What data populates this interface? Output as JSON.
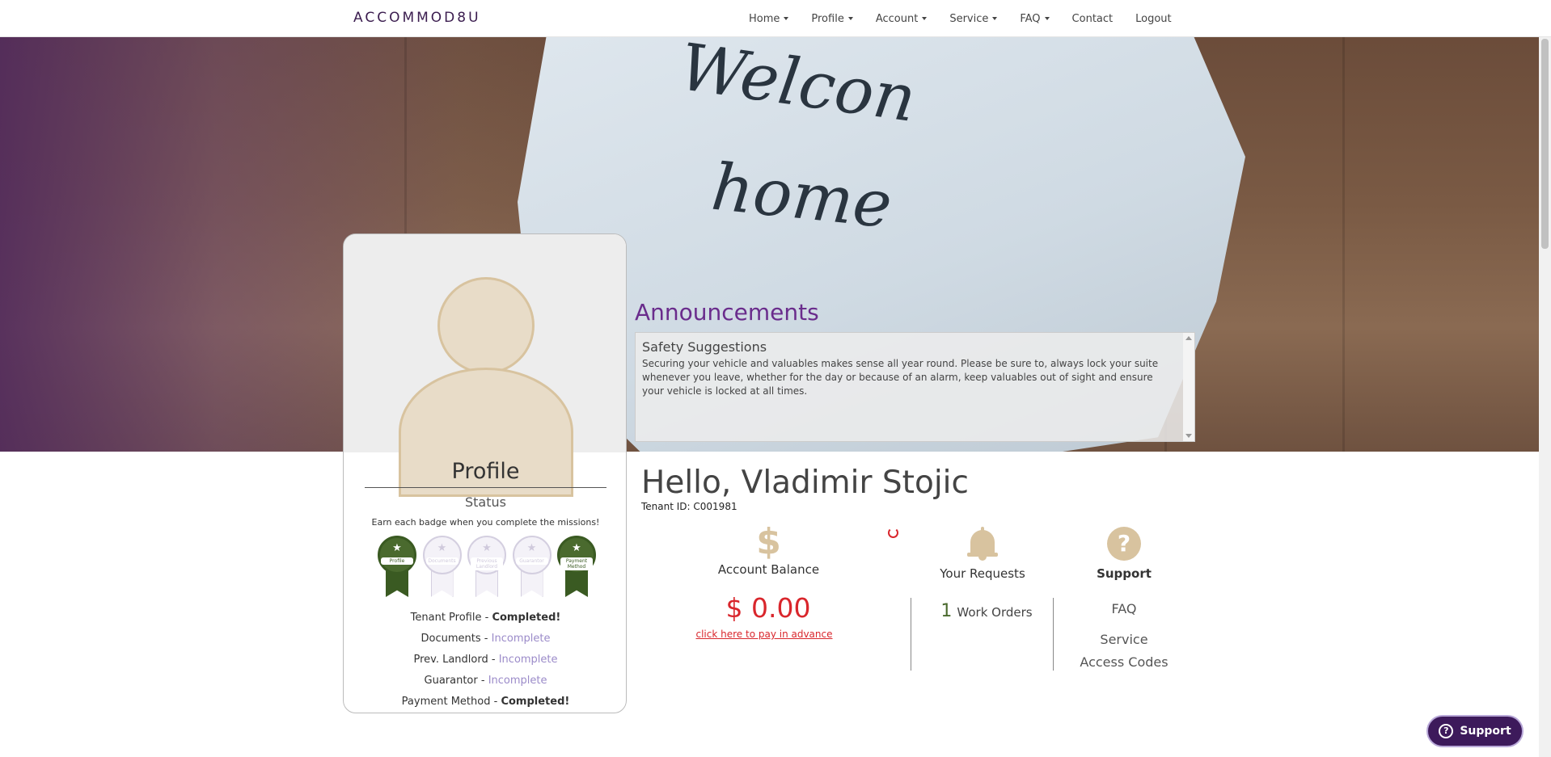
{
  "brand": "ACCOMMOD8U",
  "nav": {
    "home": "Home",
    "profile": "Profile",
    "account": "Account",
    "service": "Service",
    "faq": "FAQ",
    "contact": "Contact",
    "logout": "Logout"
  },
  "hero": {
    "line1": "Welcon",
    "line2": "home"
  },
  "announcements": {
    "title": "Announcements",
    "item_title": "Safety Suggestions",
    "item_body": "Securing your vehicle and valuables makes sense all year round. Please be sure to, always lock your suite whenever you leave, whether for the day or because of an alarm, keep valuables out of sight and ensure your vehicle is locked at all times."
  },
  "profile": {
    "title": "Profile",
    "status_label": "Status",
    "badge_note": "Earn each badge when you complete the missions!",
    "badges": [
      {
        "label": "Profile",
        "state": "done"
      },
      {
        "label": "Documents",
        "state": "todo"
      },
      {
        "label": "Previous Landlord",
        "state": "todo"
      },
      {
        "label": "Guarantor",
        "state": "todo"
      },
      {
        "label": "Payment Method",
        "state": "done"
      }
    ],
    "missions": [
      {
        "name": "Tenant Profile",
        "status": "Completed!"
      },
      {
        "name": "Documents",
        "status": "Incomplete"
      },
      {
        "name": "Prev. Landlord",
        "status": "Incomplete"
      },
      {
        "name": "Guarantor",
        "status": "Incomplete"
      },
      {
        "name": "Payment Method",
        "status": "Completed!"
      }
    ]
  },
  "dashboard": {
    "greeting": "Hello, Vladimir Stojic",
    "tenant_id": "Tenant ID: C001981",
    "balance_icon": "$",
    "balance_label": "Account Balance",
    "balance_amount": "$ 0.00",
    "pay_link": "click here to pay in advance",
    "requests_label": "Your Requests",
    "requests_count": "1",
    "requests_unit": "Work Orders",
    "support_label": "Support",
    "support_icon": "?",
    "support_links": [
      "FAQ",
      "Service",
      "Access Codes"
    ]
  },
  "support_button": {
    "icon": "?",
    "label": "Support"
  },
  "colors": {
    "brand_purple": "#3b1d4f",
    "accent_tan": "#d8c39f",
    "alert_red": "#d9262c",
    "badge_green": "#4a6a2e"
  }
}
